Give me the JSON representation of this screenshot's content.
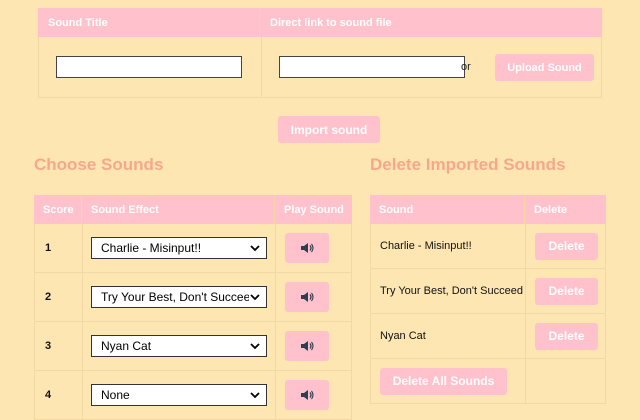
{
  "import_table": {
    "col_title": "Sound Title",
    "col_link": "Direct link to sound file",
    "title_value": "",
    "link_value": "",
    "or_label": "or",
    "upload_label": "Upload Sound"
  },
  "import_button": "Import sound",
  "choose": {
    "heading": "Choose Sounds",
    "col_score": "Score",
    "col_effect": "Sound Effect",
    "col_play": "Play Sound",
    "rows": [
      {
        "score": "1",
        "effect": "Charlie - Misinput!!"
      },
      {
        "score": "2",
        "effect": "Try Your Best, Don't Succeed"
      },
      {
        "score": "3",
        "effect": "Nyan Cat"
      },
      {
        "score": "4",
        "effect": "None"
      }
    ]
  },
  "delete": {
    "heading": "Delete Imported Sounds",
    "col_sound": "Sound",
    "col_delete": "Delete",
    "rows": [
      {
        "sound": "Charlie - Misinput!!",
        "button": "Delete"
      },
      {
        "sound": "Try Your Best, Don't Succeed",
        "button": "Delete"
      },
      {
        "sound": "Nyan Cat",
        "button": "Delete"
      }
    ],
    "delete_all": "Delete All Sounds"
  },
  "colors": {
    "background": "#fee6b3",
    "accent": "#ffc1cc",
    "heading": "#f7a88c"
  },
  "icons": {
    "play": "speaker-icon",
    "dropdown": "chevron-down-icon"
  }
}
